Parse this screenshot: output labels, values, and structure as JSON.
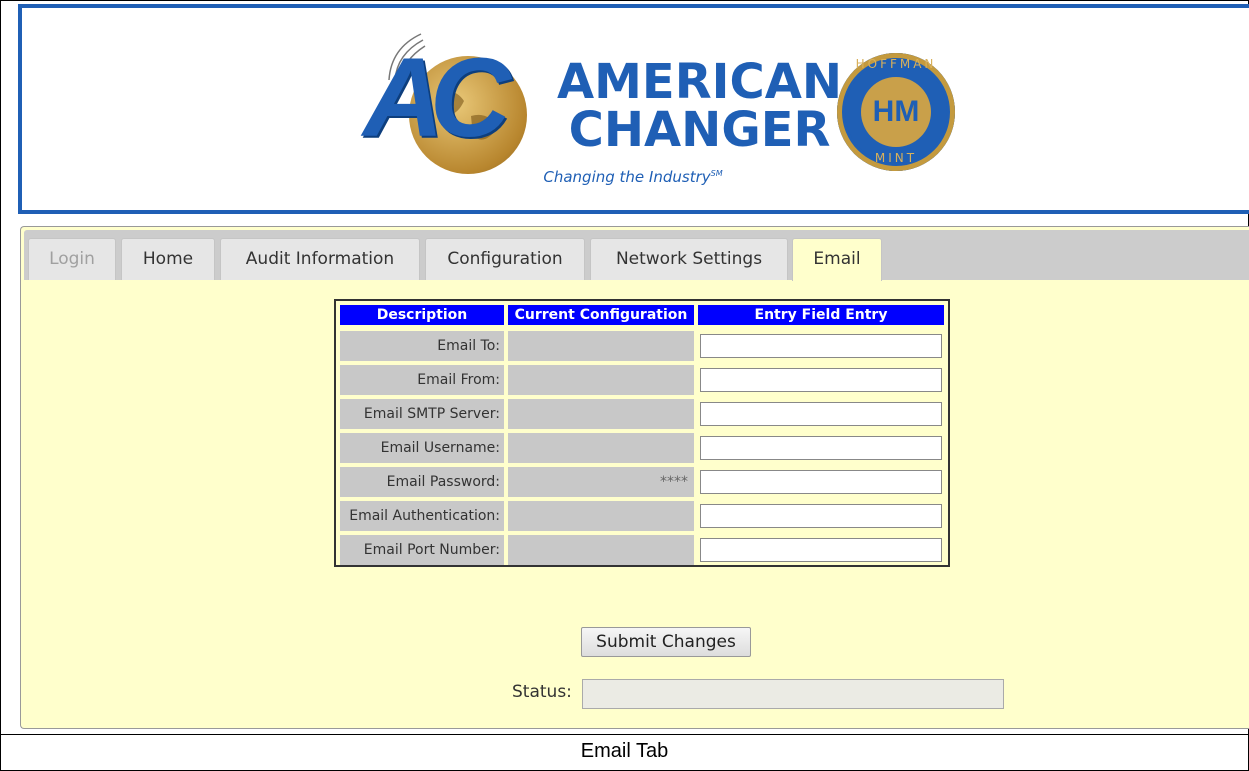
{
  "header": {
    "logo_line1": "AMERICAN",
    "logo_line2": "CHANGER",
    "logo_hm_initials": "HM",
    "logo_hm_top": "HOFFMAN",
    "logo_hm_bottom": "MINT",
    "tagline": "Changing the Industry",
    "tagline_mark": "SM"
  },
  "tabs": [
    {
      "label": "Login",
      "state": "disabled"
    },
    {
      "label": "Home",
      "state": "normal"
    },
    {
      "label": "Audit Information",
      "state": "normal"
    },
    {
      "label": "Configuration",
      "state": "normal"
    },
    {
      "label": "Network Settings",
      "state": "normal"
    },
    {
      "label": "Email",
      "state": "active"
    }
  ],
  "table": {
    "headers": [
      "Description",
      "Current Configuration",
      "Entry Field Entry"
    ],
    "rows": [
      {
        "description": "Email To:",
        "current": "",
        "entry": ""
      },
      {
        "description": "Email From:",
        "current": "",
        "entry": ""
      },
      {
        "description": "Email SMTP Server:",
        "current": "",
        "entry": ""
      },
      {
        "description": "Email Username:",
        "current": "",
        "entry": ""
      },
      {
        "description": "Email Password:",
        "current": "****",
        "entry": ""
      },
      {
        "description": "Email Authentication:",
        "current": "",
        "entry": ""
      },
      {
        "description": "Email Port Number:",
        "current": "",
        "entry": ""
      }
    ]
  },
  "submit_label": "Submit Changes",
  "status": {
    "label": "Status:",
    "value": ""
  },
  "caption": "Email Tab",
  "colors": {
    "brand_blue": "#1f5fb5",
    "header_blue": "#0000ff",
    "panel_yellow": "#ffffcc",
    "gold": "#c49a3e"
  }
}
